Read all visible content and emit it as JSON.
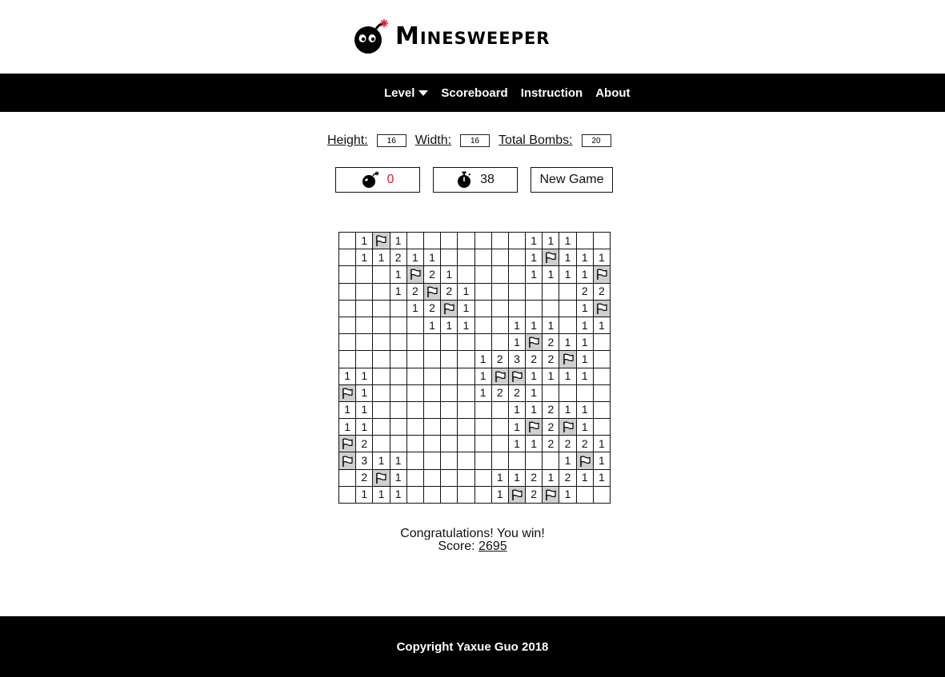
{
  "app": {
    "title": "Minesweeper",
    "logo_icon": "bomb-icon"
  },
  "nav": {
    "items": [
      {
        "label": "Level",
        "has_dropdown": true
      },
      {
        "label": "Scoreboard"
      },
      {
        "label": "Instruction"
      },
      {
        "label": "About"
      }
    ]
  },
  "settings": {
    "height_label": "Height:",
    "height_value": "16",
    "width_label": "Width:",
    "width_value": "16",
    "bombs_label": "Total Bombs:",
    "bombs_value": "20"
  },
  "controls": {
    "bombs_remaining": "0",
    "timer": "38",
    "new_game_label": "New Game",
    "bomb_count_color": "#e8162c"
  },
  "board": {
    "rows": 16,
    "cols": 16,
    "flag_icon": "flag-icon",
    "cells": [
      [
        "",
        "1",
        "F",
        "1",
        "",
        "",
        "",
        "",
        "",
        "",
        "",
        "1",
        "1",
        "1",
        "",
        ""
      ],
      [
        "",
        "1",
        "1",
        "2",
        "1",
        "1",
        "",
        "",
        "",
        "",
        "",
        "1",
        "F",
        "1",
        "1",
        "1"
      ],
      [
        "",
        "",
        "",
        "1",
        "F",
        "2",
        "1",
        "",
        "",
        "",
        "",
        "1",
        "1",
        "1",
        "1",
        "F"
      ],
      [
        "",
        "",
        "",
        "1",
        "2",
        "F",
        "2",
        "1",
        "",
        "",
        "",
        "",
        "",
        "",
        "2",
        "2"
      ],
      [
        "",
        "",
        "",
        "",
        "1",
        "2",
        "F",
        "1",
        "",
        "",
        "",
        "",
        "",
        "",
        "1",
        "F"
      ],
      [
        "",
        "",
        "",
        "",
        "",
        "1",
        "1",
        "1",
        "",
        "",
        "1",
        "1",
        "1",
        "",
        "1",
        "1"
      ],
      [
        "",
        "",
        "",
        "",
        "",
        "",
        "",
        "",
        "",
        "",
        "1",
        "F",
        "2",
        "1",
        "1",
        ""
      ],
      [
        "",
        "",
        "",
        "",
        "",
        "",
        "",
        "",
        "1",
        "2",
        "3",
        "2",
        "2",
        "F",
        "1",
        ""
      ],
      [
        "1",
        "1",
        "",
        "",
        "",
        "",
        "",
        "",
        "1",
        "F",
        "F",
        "1",
        "1",
        "1",
        "1",
        ""
      ],
      [
        "F",
        "1",
        "",
        "",
        "",
        "",
        "",
        "",
        "1",
        "2",
        "2",
        "1",
        "",
        "",
        "",
        ""
      ],
      [
        "1",
        "1",
        "",
        "",
        "",
        "",
        "",
        "",
        "",
        "",
        "1",
        "1",
        "2",
        "1",
        "1",
        ""
      ],
      [
        "1",
        "1",
        "",
        "",
        "",
        "",
        "",
        "",
        "",
        "",
        "1",
        "F",
        "2",
        "F",
        "1",
        ""
      ],
      [
        "F",
        "2",
        "",
        "",
        "",
        "",
        "",
        "",
        "",
        "",
        "1",
        "1",
        "2",
        "2",
        "2",
        "1"
      ],
      [
        "F",
        "3",
        "1",
        "1",
        "",
        "",
        "",
        "",
        "",
        "",
        "",
        "",
        "",
        "1",
        "F",
        "1"
      ],
      [
        "",
        "2",
        "F",
        "1",
        "",
        "",
        "",
        "",
        "",
        "1",
        "1",
        "2",
        "1",
        "2",
        "1",
        "1"
      ],
      [
        "",
        "1",
        "1",
        "1",
        "",
        "",
        "",
        "",
        "",
        "1",
        "F",
        "2",
        "F",
        "1",
        "",
        ""
      ]
    ]
  },
  "result": {
    "message": "Congratulations! You win!",
    "score_label": "Score:",
    "score_value": "2695"
  },
  "footer": {
    "copyright": "Copyright Yaxue Guo 2018"
  }
}
